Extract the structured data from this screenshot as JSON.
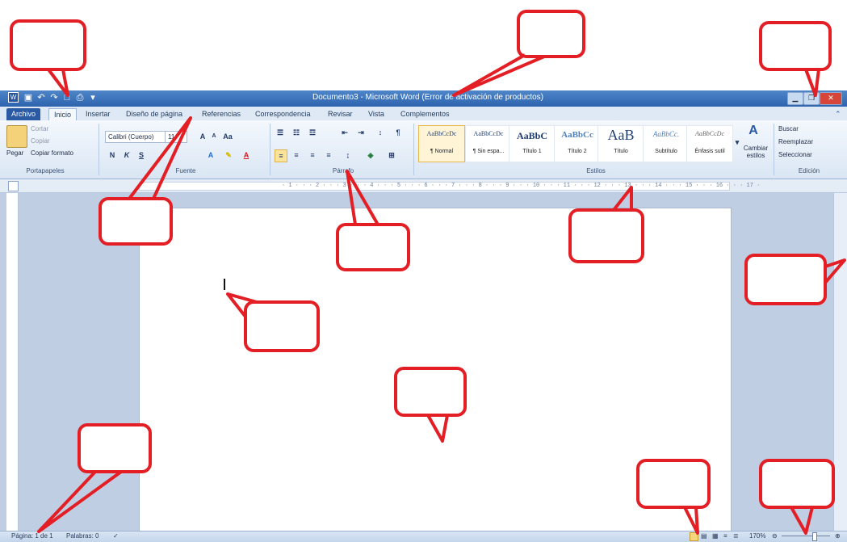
{
  "window": {
    "title": "Documento3 - Microsoft Word (Error de activación de productos)"
  },
  "quick_access": {
    "icons": [
      "word-logo-icon",
      "save-icon",
      "undo-icon",
      "redo-icon",
      "print-icon",
      "customize-icon"
    ]
  },
  "tabs": [
    "Archivo",
    "Inicio",
    "Insertar",
    "Diseño de página",
    "Referencias",
    "Correspondencia",
    "Revisar",
    "Vista",
    "Complementos"
  ],
  "ribbon": {
    "portapapeles": {
      "paste": "Pegar",
      "cut": "Cortar",
      "copy": "Copiar",
      "format_painter": "Copiar formato",
      "label": "Portapapeles"
    },
    "fuente": {
      "font_name": "Calibri (Cuerpo)",
      "font_size": "11",
      "grow": "A",
      "shrink": "A",
      "case": "Aa",
      "bold": "N",
      "italic": "K",
      "underline": "S",
      "label": "Fuente"
    },
    "parrafo": {
      "label": "Párrafo",
      "pilcrow": "¶"
    },
    "estilos": {
      "label": "Estilos",
      "change_styles": "Cambiar estilos",
      "items": [
        {
          "preview": "AaBbCcDc",
          "name": "¶ Normal"
        },
        {
          "preview": "AaBbCcDc",
          "name": "¶ Sin espa..."
        },
        {
          "preview": "AaBbC",
          "name": "Título 1"
        },
        {
          "preview": "AaBbCc",
          "name": "Título 2"
        },
        {
          "preview": "AaB",
          "name": "Título"
        },
        {
          "preview": "AaBbCc.",
          "name": "Subtítulo"
        },
        {
          "preview": "AaBbCcDc",
          "name": "Énfasis sutil"
        }
      ]
    },
    "edicion": {
      "find": "Buscar",
      "replace": "Reemplazar",
      "select": "Seleccionar",
      "label": "Edición"
    }
  },
  "ruler": {
    "marks": "· 1 · · · 2 · · · 3 · · · 4 · · · 5 · · · 6 · · · 7 · · · 8 · · · 9 · · · 10 · · · 11 · · · 12 · · · 13 · · · 14 · · · 15 · · · 16 · · · 17 ·"
  },
  "status": {
    "page": "Página: 1 de 1",
    "words": "Palabras: 0",
    "zoom": "170%"
  },
  "colors": {
    "callout_border": "#e31e24",
    "title_bar": "#2d63ad",
    "file_tab": "#2a5aa3"
  }
}
